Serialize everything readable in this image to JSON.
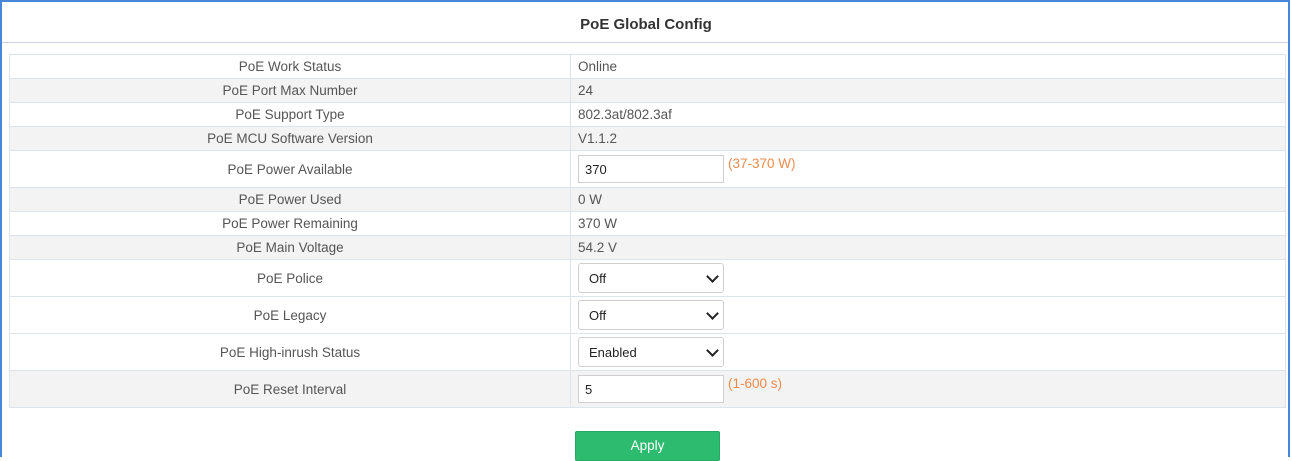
{
  "page": {
    "title": "PoE Global Config"
  },
  "rows": {
    "work_status": {
      "label": "PoE Work Status",
      "value": "Online"
    },
    "port_max": {
      "label": "PoE Port Max Number",
      "value": "24"
    },
    "support_type": {
      "label": "PoE Support Type",
      "value": "802.3at/802.3af"
    },
    "mcu_version": {
      "label": "PoE MCU Software Version",
      "value": "V1.1.2"
    },
    "power_available": {
      "label": "PoE Power Available",
      "value": "370",
      "hint": "(37-370 W)"
    },
    "power_used": {
      "label": "PoE Power Used",
      "value": "0 W"
    },
    "power_remaining": {
      "label": "PoE Power Remaining",
      "value": "370 W"
    },
    "main_voltage": {
      "label": "PoE Main Voltage",
      "value": "54.2 V"
    },
    "police": {
      "label": "PoE Police",
      "selected": "Off"
    },
    "legacy": {
      "label": "PoE Legacy",
      "selected": "Off"
    },
    "high_inrush": {
      "label": "PoE High-inrush Status",
      "selected": "Enabled"
    },
    "reset_interval": {
      "label": "PoE Reset Interval",
      "value": "5",
      "hint": "(1-600 s)"
    }
  },
  "actions": {
    "apply_label": "Apply"
  },
  "colors": {
    "frame": "#4a86d8",
    "hint": "#f08a4b",
    "apply_bg": "#2dbb70",
    "alt_row": "#f3f3f3"
  }
}
